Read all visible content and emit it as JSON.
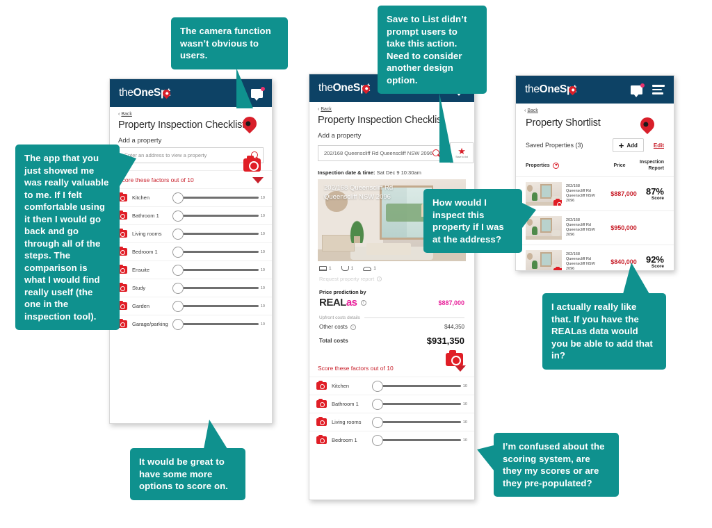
{
  "meta": {
    "teal": "#0f918e",
    "navy": "#0d4265",
    "red": "#d81f2a",
    "pink": "#e8239b"
  },
  "brand": {
    "pre": "the",
    "mid": "One",
    "post": "Sp",
    "tail": "t",
    "icon": "map-pin-icon"
  },
  "screen1": {
    "back": "Back",
    "title": "Property Inspection Checklist",
    "add_label": "Add a property",
    "search_placeholder": "Enter an address to view a property",
    "search_value": "",
    "score_heading": "Score these factors out of 10",
    "slider_min": "0",
    "slider_max": "10",
    "factors": [
      "Kitchen",
      "Bathroom 1",
      "Living rooms",
      "Bedroom 1",
      "Ensuite",
      "Study",
      "Garden",
      "Garage/parking"
    ]
  },
  "screen2": {
    "back": "Back",
    "title": "Property Inspection Checklist",
    "add_label": "Add a property",
    "search_value": "202/168 Queenscliff Rd Queenscliff NSW 2096",
    "save_button_label": "Save to list",
    "inspection_label": "Inspection date & time:",
    "inspection_value": "Sat Dec 9 10:30am",
    "photo_address_line1": "202/168 Queenscliff Rd",
    "photo_address_line2": "Queenscliff NSW 2096",
    "amenities": [
      {
        "icon": "bed-icon",
        "count": "1"
      },
      {
        "icon": "bath-icon",
        "count": "1"
      },
      {
        "icon": "car-icon",
        "count": "1"
      }
    ],
    "request_report": "Request property report",
    "price_prediction_label": "Price prediction by",
    "realas_brand_main": "REAL",
    "realas_brand_accent": "as",
    "predicted_price": "$887,000",
    "upfront_label": "Upfront costs details",
    "other_costs_label": "Other costs",
    "other_costs_value": "$44,350",
    "total_costs_label": "Total costs",
    "total_costs_value": "$931,350",
    "score_heading": "Score these factors out of 10",
    "slider_min": "0",
    "slider_max": "10",
    "factors": [
      "Kitchen",
      "Bathroom 1",
      "Living rooms",
      "Bedroom 1"
    ]
  },
  "screen3": {
    "back": "Back",
    "title": "Property Shortlist",
    "saved_label": "Saved Properties (3)",
    "add_button": "Add",
    "edit_link": "Edit",
    "columns": {
      "properties": "Properties",
      "price": "Price",
      "report_line1": "Inspection",
      "report_line2": "Report"
    },
    "score_suffix": "Score",
    "rows": [
      {
        "addr1": "202/168",
        "addr2": "Queenscliff Rd",
        "addr3": "Queenscliff NSW",
        "addr4": "2096",
        "price": "$887,000",
        "score": "87%",
        "has_camera": true
      },
      {
        "addr1": "202/168",
        "addr2": "Queenscliff Rd",
        "addr3": "Queenscliff NSW",
        "addr4": "2096",
        "price": "$950,000",
        "score": "",
        "has_camera": false
      },
      {
        "addr1": "202/168",
        "addr2": "Queenscliff Rd",
        "addr3": "Queenscliff NSW",
        "addr4": "2096",
        "price": "$840,000",
        "score": "92%",
        "has_camera": true
      }
    ]
  },
  "callouts": {
    "camera": "The camera function wasn’t obvious to users.",
    "save_to_list": "Save to List didn’t prompt users to take this action. Need to consider another design option.",
    "valuable": "The app that you just showed me was really valuable to me. If I felt comfortable using it then I would go back and go through all of the steps. The comparison is what I would find really uself (the one in the inspection tool).",
    "inspect_address": "How would I inspect this property if I was at the address?",
    "realas_data": "I actually really like that. If you have the REALas data would you be able to add that in?",
    "more_options": "It would be great to have some more options to score on.",
    "scoring_confused": "I’m confused about the scoring system, are they my scores or are they pre-populated?"
  }
}
